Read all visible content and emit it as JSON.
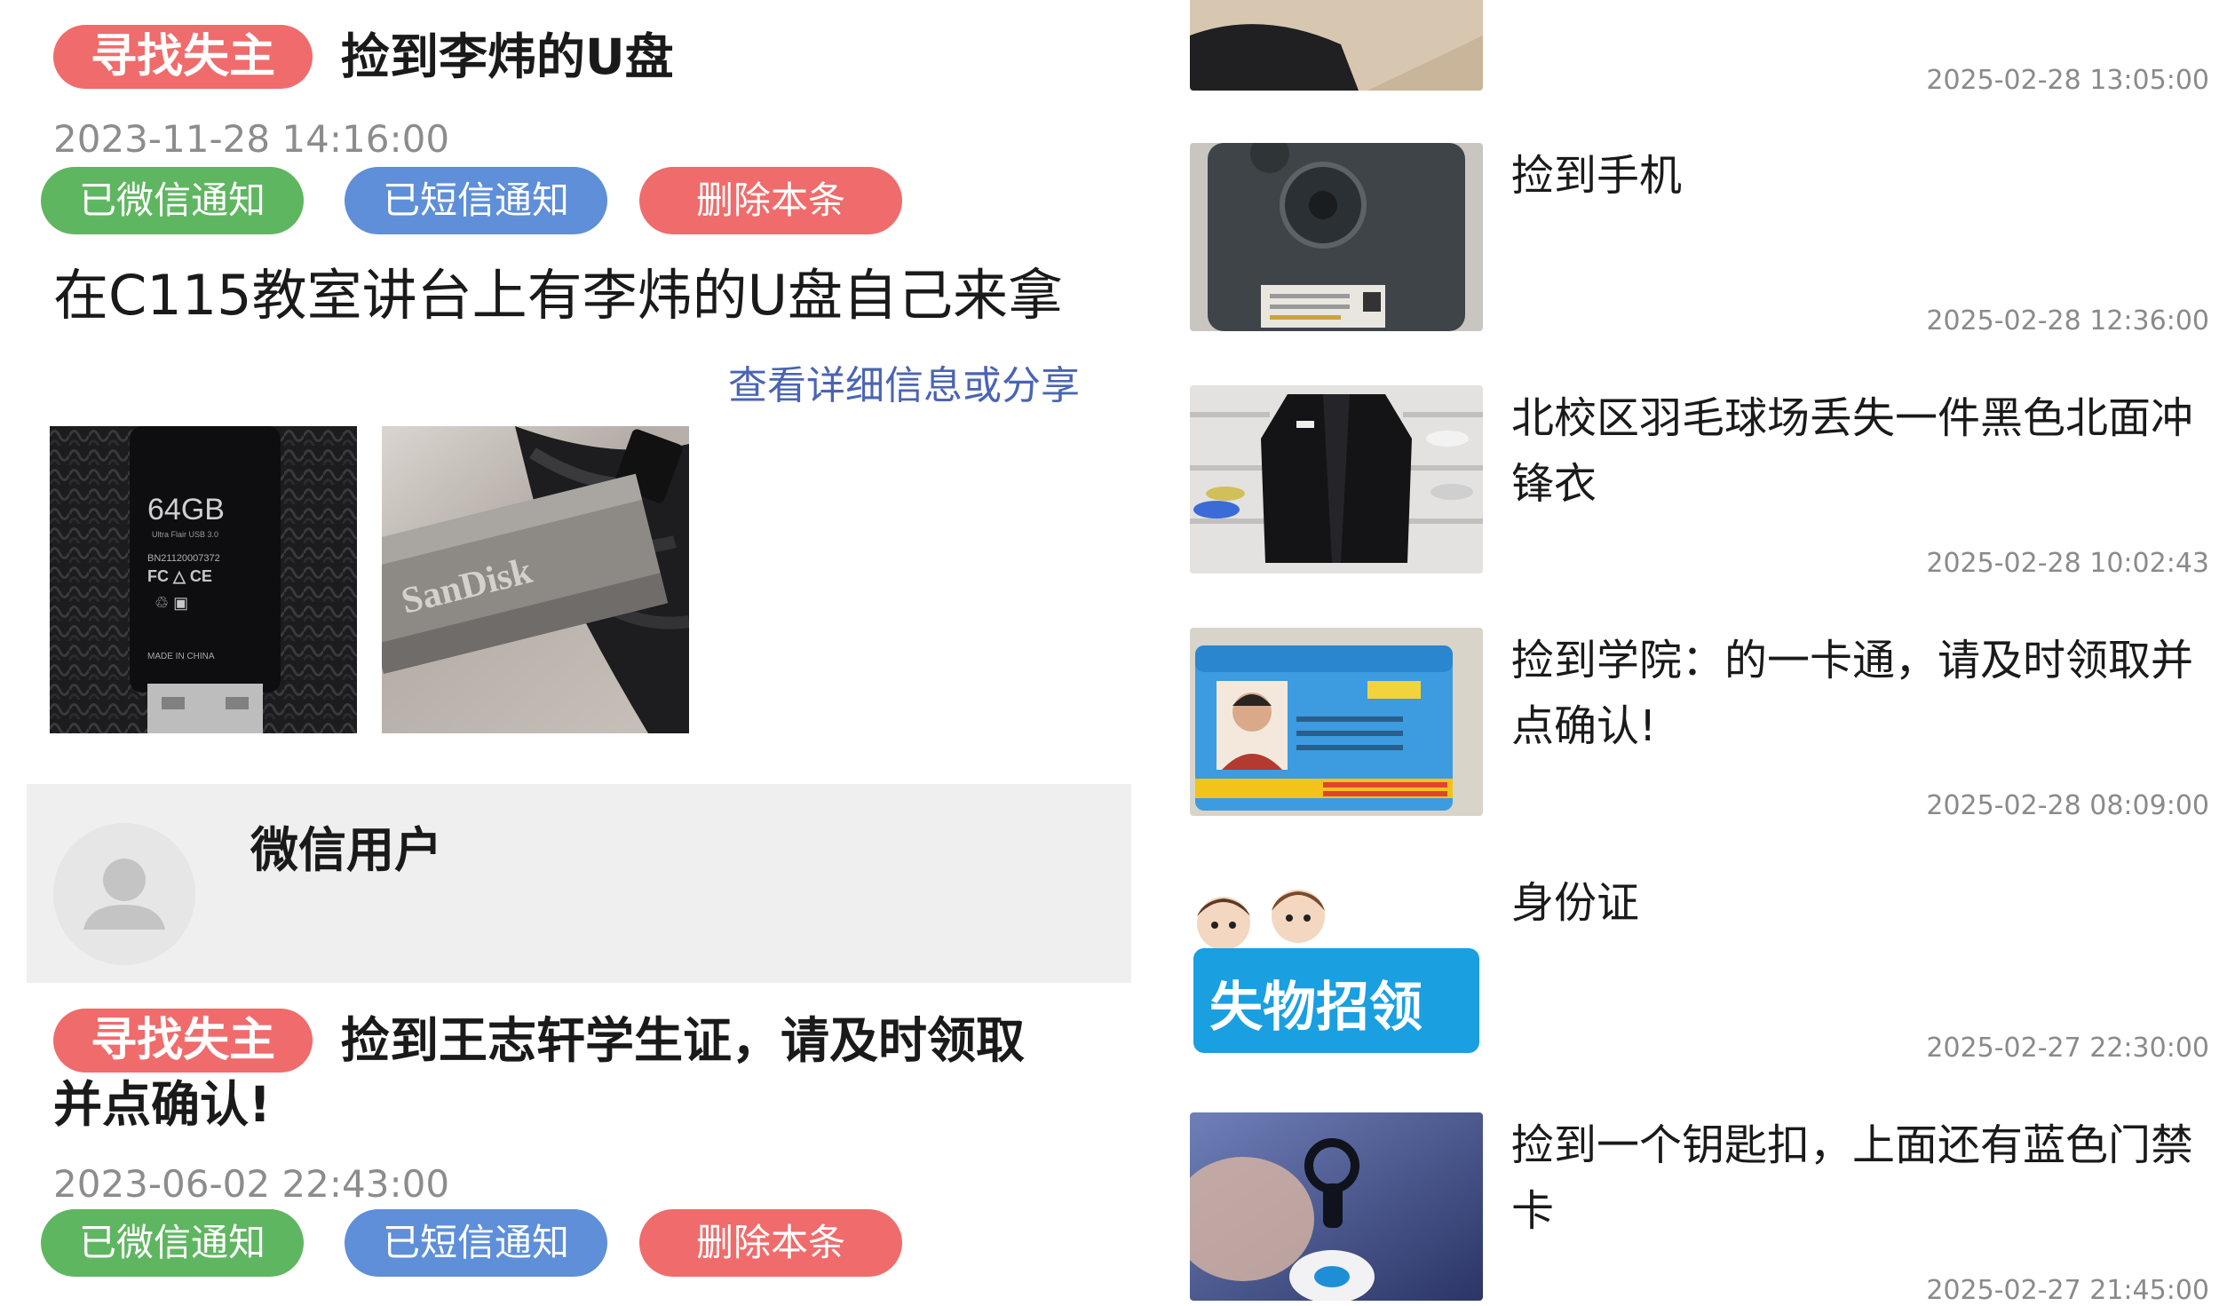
{
  "posts": [
    {
      "tag": "寻找失主",
      "title": "捡到李炜的U盘",
      "date": "2023-11-28 14:16:00",
      "buttons": {
        "wechat": "已微信通知",
        "sms": "已短信通知",
        "delete": "删除本条"
      },
      "body": "在C115教室讲台上有李炜的U盘自己来拿",
      "detail_link": "查看详细信息或分享",
      "photos": [
        {
          "icon": "usb-drive-photo",
          "text": "64GB",
          "subtext": "Ultra Flair USB 3.0",
          "serial": "BN21120007372",
          "made": "MADE IN CHINA"
        },
        {
          "icon": "sandisk-usb-photo",
          "brand": "SanDisk"
        }
      ],
      "user": {
        "name": "微信用户",
        "avatar_icon": "default-avatar-icon"
      }
    },
    {
      "tag": "寻找失主",
      "title": "捡到王志轩学生证，请及时领取并点确认!",
      "date": "2023-06-02 22:43:00",
      "buttons": {
        "wechat": "已微信通知",
        "sms": "已短信通知",
        "delete": "删除本条"
      }
    }
  ],
  "feed": [
    {
      "title": "",
      "time": "2025-02-28 13:05:00",
      "thumb_icon": "item-photo"
    },
    {
      "title": "捡到手机",
      "time": "2025-02-28 12:36:00",
      "thumb_icon": "phone-photo"
    },
    {
      "title": "北校区羽毛球场丢失一件黑色北面冲锋衣",
      "time": "2025-02-28 10:02:43",
      "thumb_icon": "jacket-photo"
    },
    {
      "title": "捡到学院：的一卡通，请及时领取并点确认!",
      "time": "2025-02-28 08:09:00",
      "thumb_icon": "id-card-photo"
    },
    {
      "title": "身份证",
      "time": "2025-02-27 22:30:00",
      "thumb_icon": "lost-found-banner",
      "banner_text": "失物招领"
    },
    {
      "title": "捡到一个钥匙扣，上面还有蓝色门禁卡",
      "time": "2025-02-27 21:45:00",
      "thumb_icon": "keychain-photo"
    }
  ],
  "colors": {
    "tag_red": "#f06b6b",
    "green": "#5fb660",
    "blue": "#5e8fd8",
    "link": "#4a64b3",
    "card_bg": "#efefef"
  }
}
